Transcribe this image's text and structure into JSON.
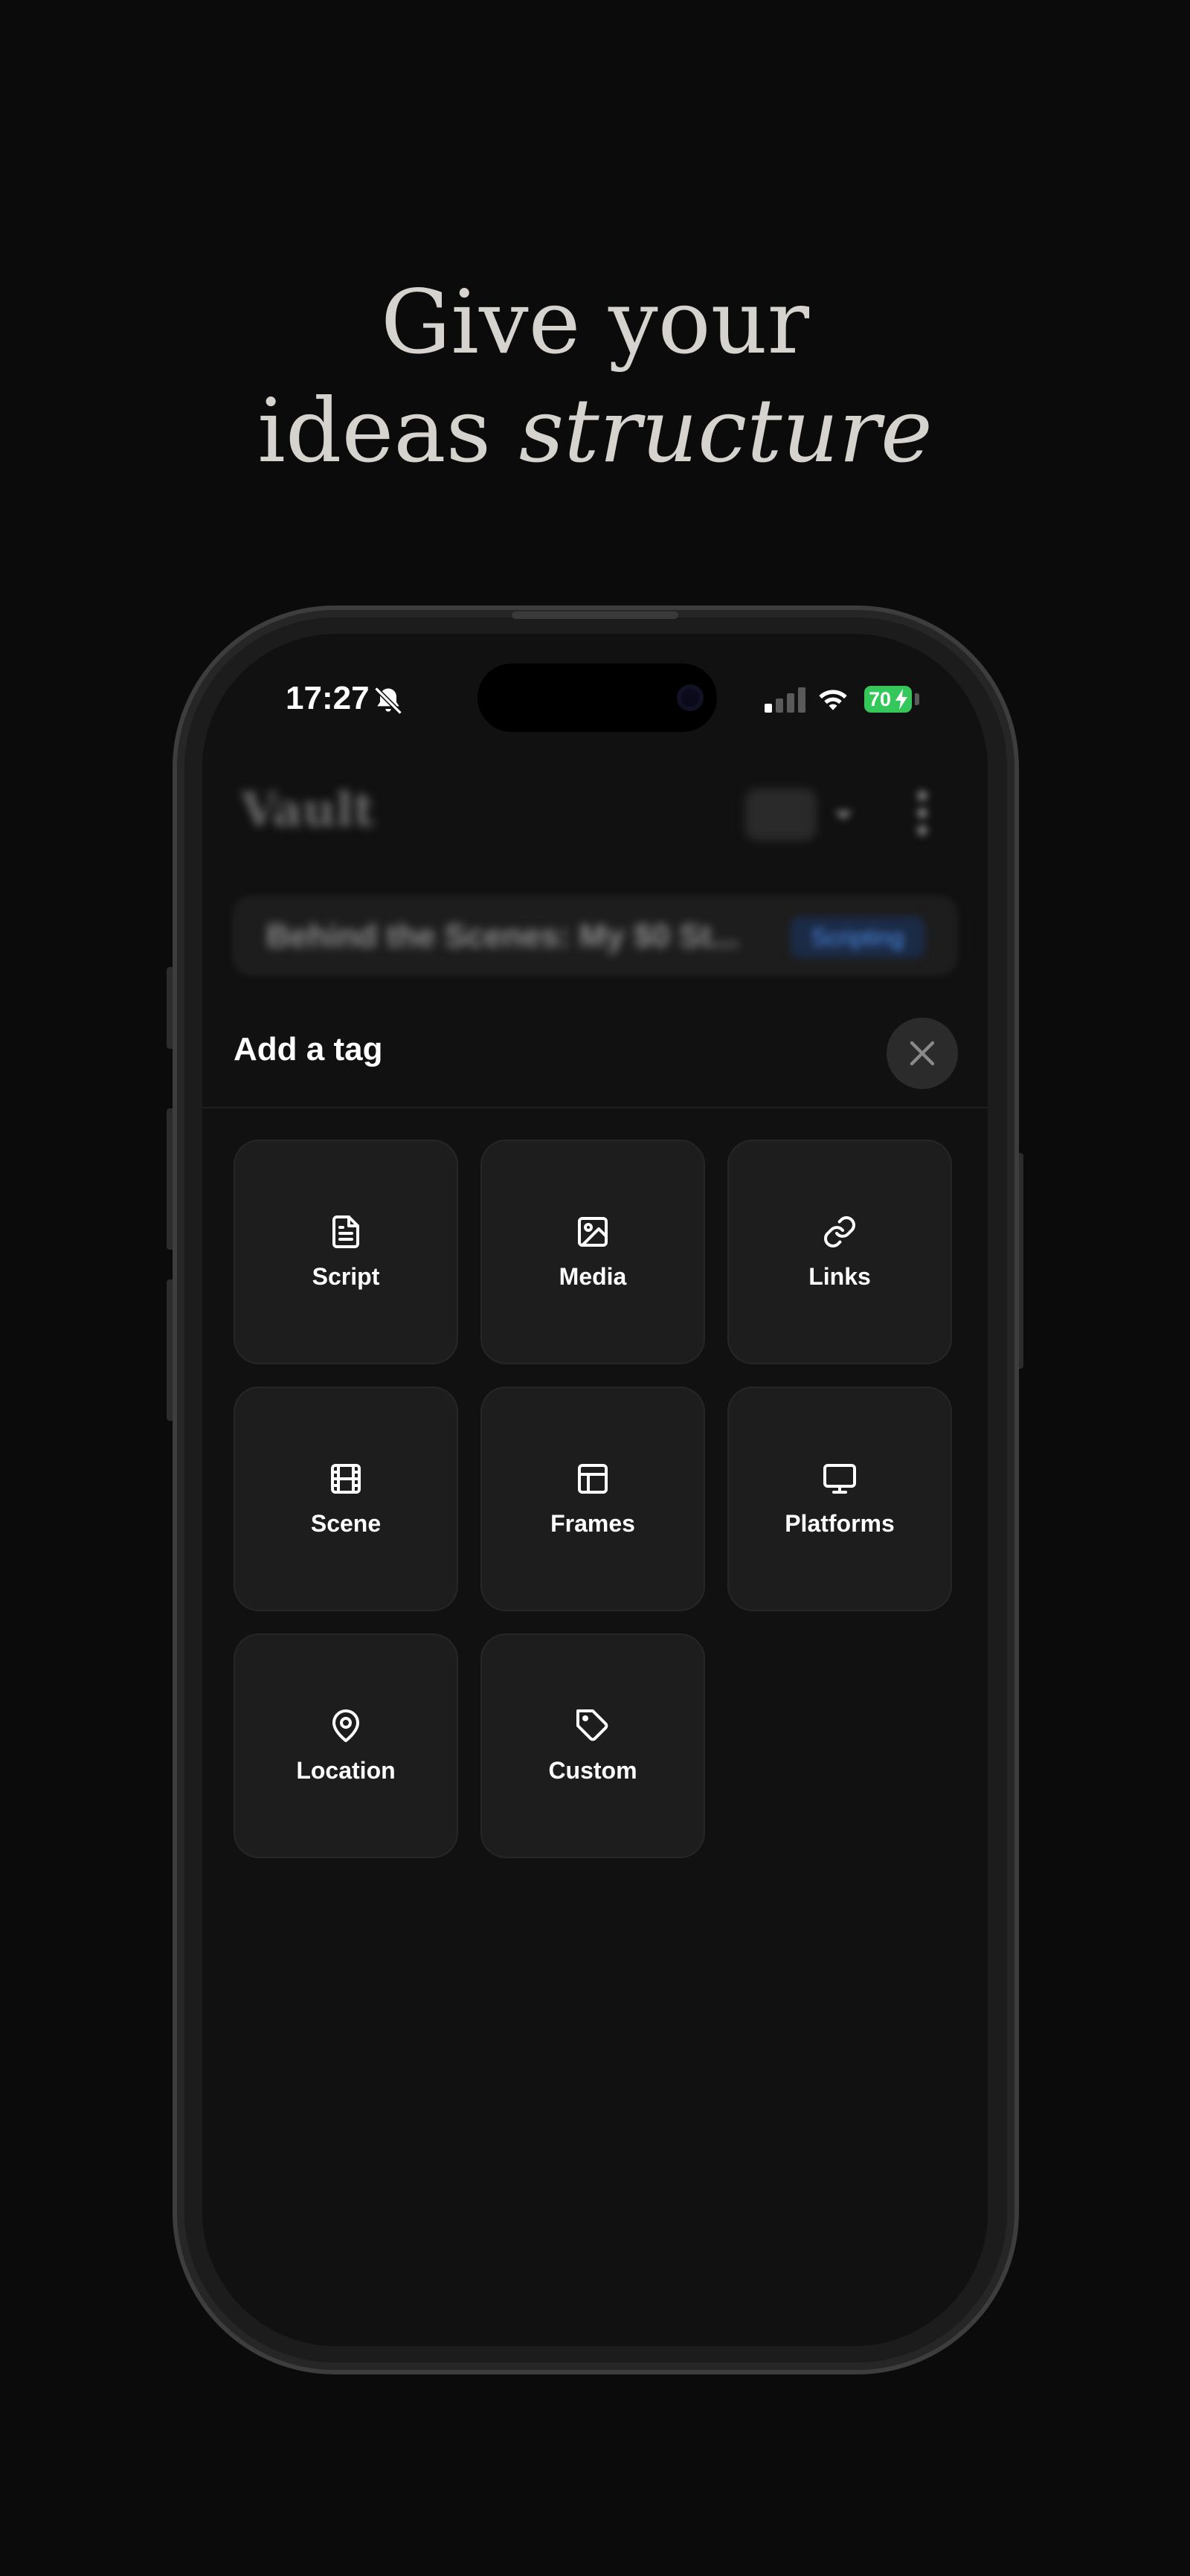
{
  "headline": {
    "line1": "Give your",
    "line2_plain": "ideas ",
    "line2_italic": "structure"
  },
  "status_bar": {
    "time": "17:27",
    "battery": "70"
  },
  "background_app": {
    "title": "Vault",
    "card_text": "Behind the Scenes: My $0 St...",
    "card_badge": "Scripting"
  },
  "sheet": {
    "title": "Add a tag",
    "tiles": [
      {
        "label": "Script",
        "icon": "file-text-icon"
      },
      {
        "label": "Media",
        "icon": "image-icon"
      },
      {
        "label": "Links",
        "icon": "link-icon"
      },
      {
        "label": "Scene",
        "icon": "film-icon"
      },
      {
        "label": "Frames",
        "icon": "layout-icon"
      },
      {
        "label": "Platforms",
        "icon": "monitor-icon"
      },
      {
        "label": "Location",
        "icon": "map-pin-icon"
      },
      {
        "label": "Custom",
        "icon": "tag-icon"
      }
    ]
  },
  "colors": {
    "background": "#0b0b0b",
    "tile": "#1d1d1d",
    "battery": "#34c759",
    "badge_text": "#4c8de8"
  }
}
